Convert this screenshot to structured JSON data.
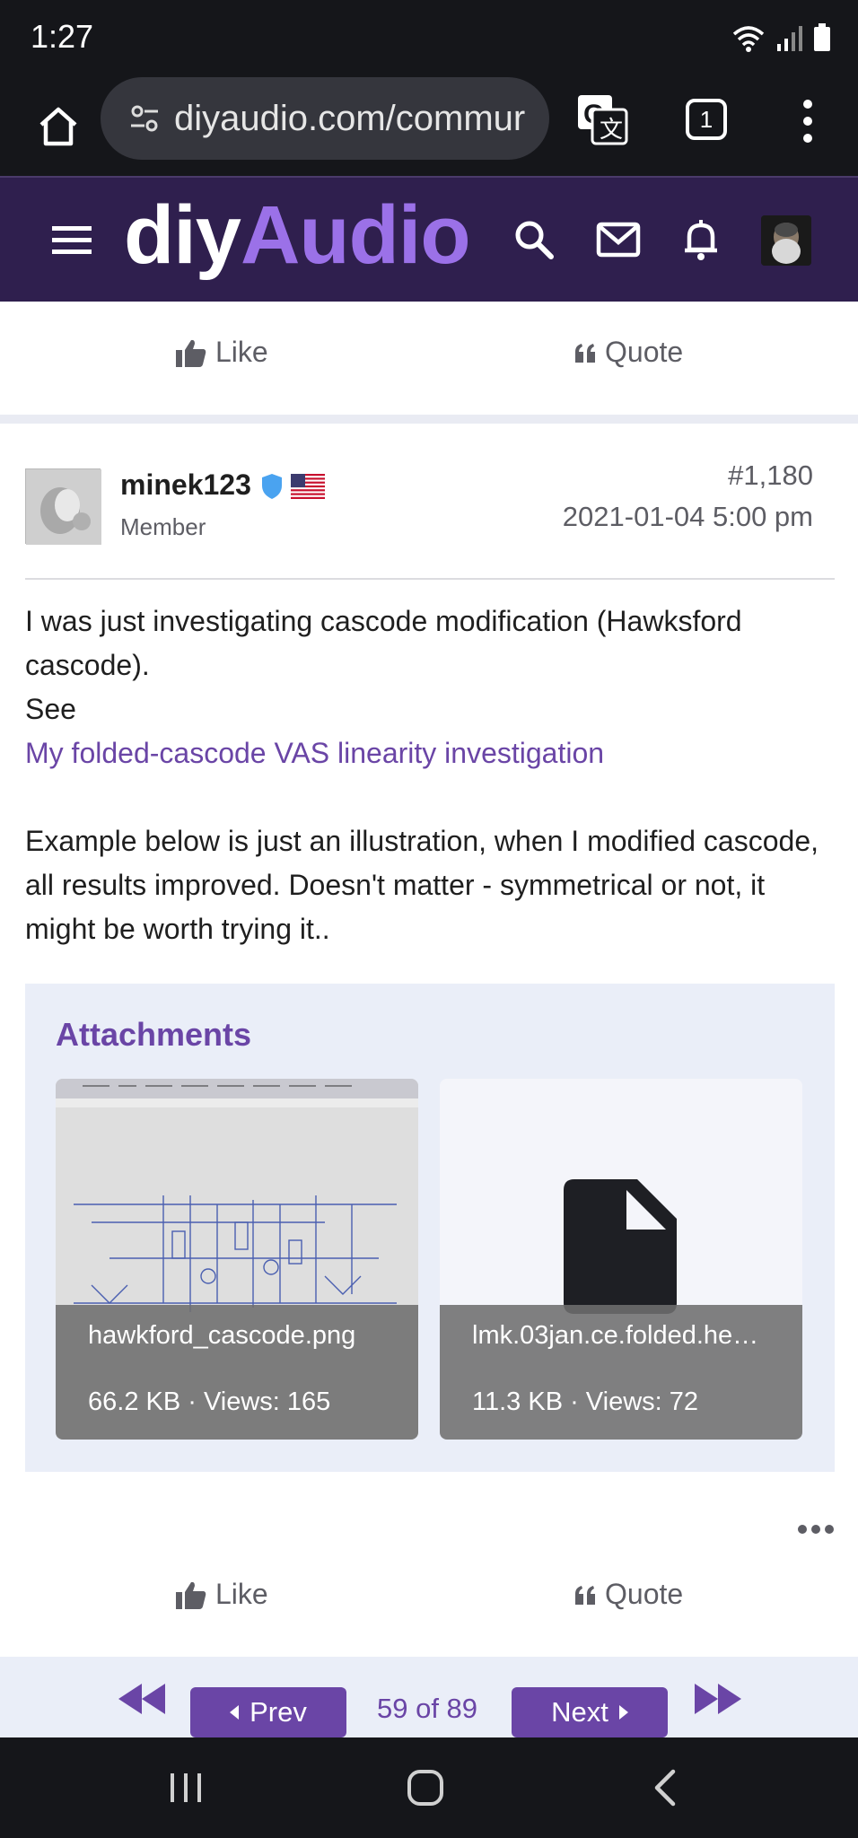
{
  "status": {
    "time": "1:27",
    "icons": [
      "wifi-icon",
      "signal-icon",
      "battery-icon"
    ]
  },
  "browser": {
    "url": "diyaudio.com/commur",
    "tab_count": "1",
    "icons": [
      "home-icon",
      "site-settings-icon",
      "translate-icon",
      "kebab-menu-icon"
    ]
  },
  "site": {
    "logo_part1": "diy",
    "logo_part2": "Audio",
    "brand_color": "#2f1f4e",
    "accent_color": "#9b71e8",
    "header_icons": [
      "menu-icon",
      "search-icon",
      "mail-icon",
      "bell-icon"
    ]
  },
  "actions_top": {
    "like_label": "Like",
    "quote_label": "Quote"
  },
  "post": {
    "username": "minek123",
    "role": "Member",
    "number": "#1,180",
    "date": "2021-01-04 5:00 pm",
    "paragraph1": "I was just investigating cascode modification (Hawksford cascode).",
    "see": "See",
    "link_text": "My folded-cascode VAS linearity investigation",
    "paragraph2": "Example below is just an illustration, when I modified cascode, all results improved. Doesn't matter - symmetrical or not, it might be worth trying it.."
  },
  "attachments": {
    "title": "Attachments",
    "files": [
      {
        "name": "hawkford_cascode.png",
        "meta": "66.2 KB · Views: 165"
      },
      {
        "name": "lmk.03jan.ce.folded.he…",
        "meta": "11.3 KB · Views: 72"
      }
    ]
  },
  "actions_bottom": {
    "like_label": "Like",
    "quote_label": "Quote"
  },
  "pagination": {
    "prev_label": "Prev",
    "next_label": "Next",
    "page_info": "59 of 89"
  }
}
